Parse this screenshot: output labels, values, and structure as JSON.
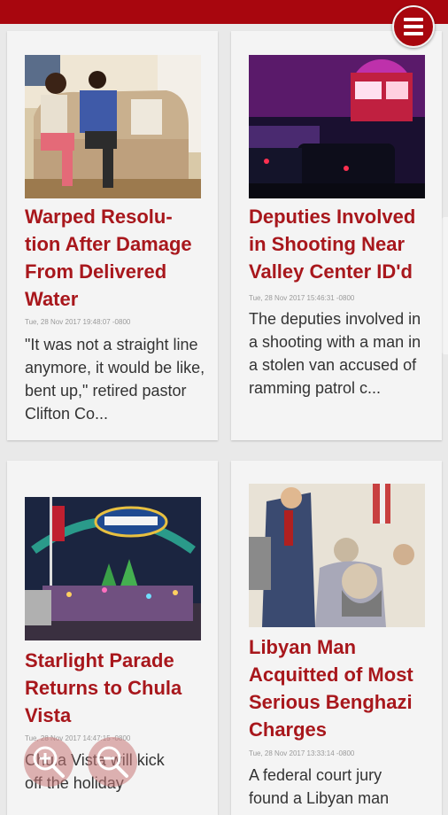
{
  "menu": {
    "icon": "menu-icon"
  },
  "articles": [
    {
      "title": "Warped Resolu-tion After Damage From Delivered Water",
      "date": "Tue, 28 Nov 2017 19:48:07 -0800",
      "summary": "\"It was not a straight line anymore, it would be like, bent up,\" retired pastor Clifton Co...",
      "image": "elderly-couple-on-couch"
    },
    {
      "title": "Deputies Involved in Shooting Near Valley Center ID'd",
      "date": "Tue, 28 Nov 2017 15:46:31 -0800",
      "summary": "The deputies involved in a shooting with a man in a stolen van accused of ramming patrol c...",
      "image": "police-scene-at-night"
    },
    {
      "title": "Starlight Parade Returns to Chula Vista",
      "date": "Tue, 28 Nov 2017 14:47:15 -0800",
      "summary": "Chula Vista will kick off the holiday",
      "image": "third-avenue-parade"
    },
    {
      "title": "Libyan Man Acquitted of Most Serious Benghazi Charges",
      "date": "Tue, 28 Nov 2017 13:33:14 -0800",
      "summary": "A federal court jury found a Libyan man",
      "image": "courtroom-sketch"
    }
  ],
  "zoom": {
    "in_icon": "zoom-in-icon",
    "out_icon": "zoom-out-icon"
  },
  "colors": {
    "brand": "#a8060e",
    "headline": "#a8171c"
  }
}
